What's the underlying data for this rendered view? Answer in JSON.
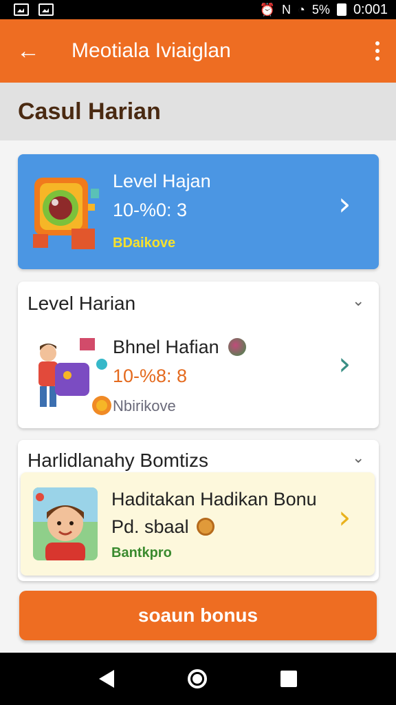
{
  "status_bar": {
    "time": "0:001",
    "battery": "5%"
  },
  "app_bar": {
    "title": "Meotiala Iviaiglan"
  },
  "section": {
    "title": "Casul Harian"
  },
  "level_card": {
    "title": "Level Hajan",
    "value": "10-%0: 3",
    "tag": "BDaikove"
  },
  "level_harian": {
    "header": "Level Harian",
    "item": {
      "title": "Bhnel Hafian",
      "value": "10-%8: 8",
      "tag": "Nbirikove"
    }
  },
  "bonus_section": {
    "header": "Harlidlanahy Bomtizs",
    "item": {
      "title": "Haditakan Hadikan Bonu",
      "subtitle": "Pd. sbaal",
      "tag": "Bantkpro"
    }
  },
  "bonus_button": {
    "label": "soaun bonus"
  },
  "colors": {
    "primary": "#ee6d22",
    "blue_card": "#4b96e3",
    "yellow_card": "#fdf8dc",
    "title_brown": "#4a2a12"
  }
}
